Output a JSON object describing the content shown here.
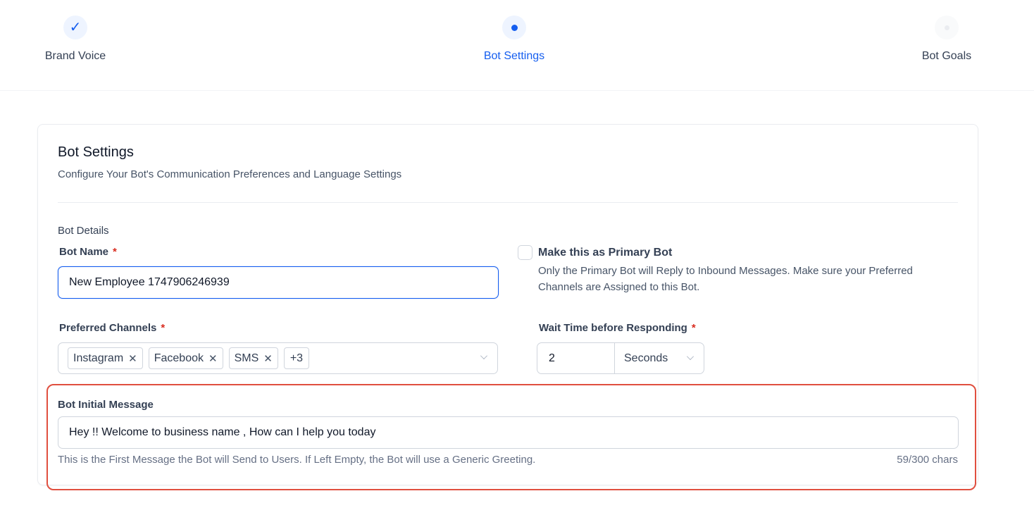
{
  "stepper": {
    "steps": [
      {
        "label": "Brand Voice",
        "state": "done"
      },
      {
        "label": "Bot Settings",
        "state": "active"
      },
      {
        "label": "Bot Goals",
        "state": "pending"
      }
    ]
  },
  "card": {
    "title": "Bot Settings",
    "subtitle": "Configure Your Bot's Communication Preferences and Language Settings",
    "section_label": "Bot Details"
  },
  "bot_name": {
    "label": "Bot Name",
    "required_mark": "*",
    "value": "New Employee 1747906246939"
  },
  "primary_bot": {
    "title": "Make this as Primary Bot",
    "description": "Only the Primary Bot will Reply to Inbound Messages. Make sure your Preferred Channels are Assigned to this Bot.",
    "checked": false
  },
  "preferred_channels": {
    "label": "Preferred Channels",
    "required_mark": "*",
    "tags": [
      "Instagram",
      "Facebook",
      "SMS"
    ],
    "remove_glyph": "✕",
    "more": "+3"
  },
  "wait_time": {
    "label": "Wait Time before Responding",
    "required_mark": "*",
    "value": "2",
    "unit": "Seconds"
  },
  "initial_message": {
    "label": "Bot Initial Message",
    "value": "Hey !! Welcome to business name , How can I help you today",
    "helper": "This is the First Message the Bot will Send to Users. If Left Empty, the Bot will use a Generic Greeting.",
    "counter": "59/300 chars"
  },
  "colors": {
    "accent": "#155eef",
    "highlight": "#e04f3f",
    "required": "#d92d20"
  }
}
